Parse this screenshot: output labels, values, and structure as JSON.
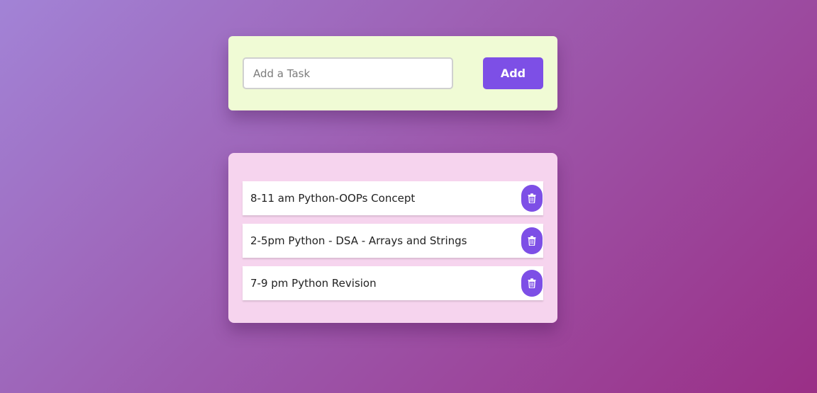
{
  "add_form": {
    "input_placeholder": "Add a Task",
    "input_value": "",
    "add_label": "Add"
  },
  "tasks": [
    {
      "text": "8-11 am Python-OOPs Concept",
      "delete_icon": "trash-icon"
    },
    {
      "text": "2-5pm Python - DSA - Arrays and Strings",
      "delete_icon": "trash-icon"
    },
    {
      "text": "7-9 pm Python Revision",
      "delete_icon": "trash-icon"
    }
  ],
  "colors": {
    "accent": "#7d4fe6",
    "add_card_background": "#f0fbd5",
    "list_card_background": "#f6d4ee",
    "page_gradient_start": "#a283d6",
    "page_gradient_end": "#9a2f86"
  }
}
